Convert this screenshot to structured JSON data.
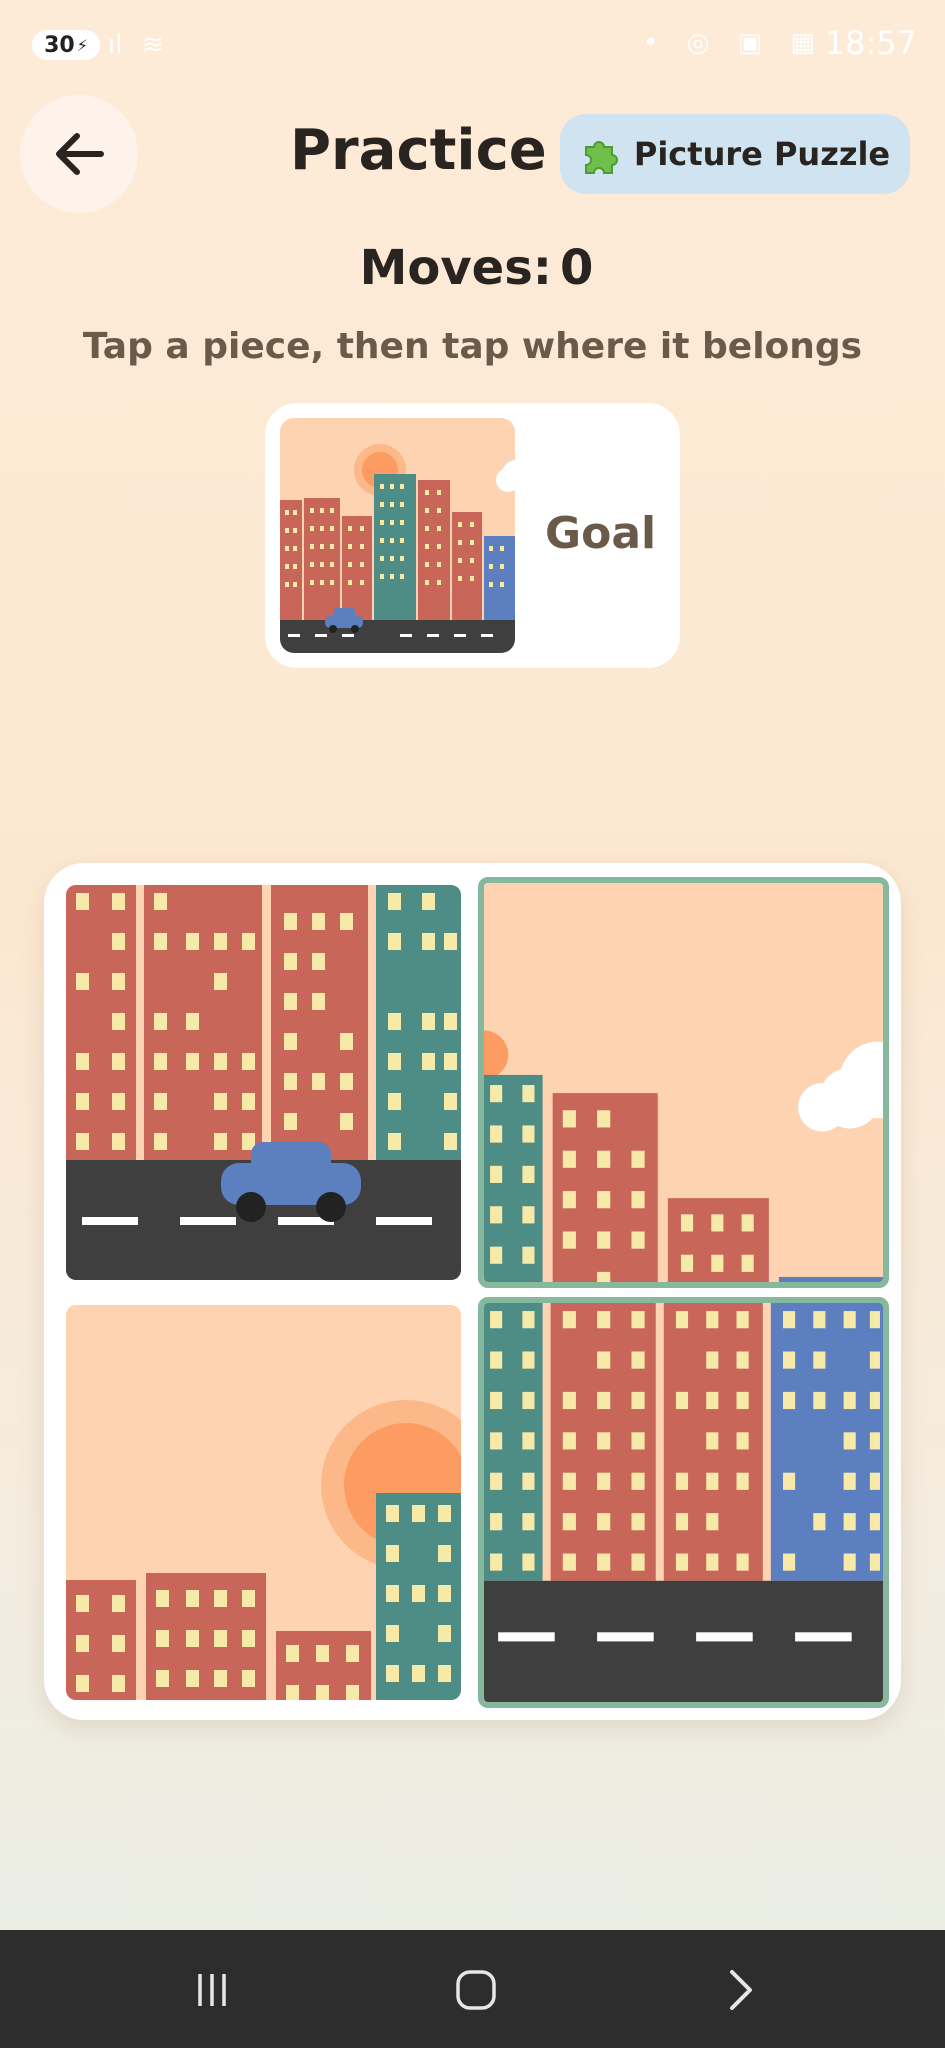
{
  "status_bar": {
    "battery": "30",
    "time": "18:57"
  },
  "header": {
    "title": "Practice",
    "mode_badge": "Picture Puzzle",
    "back_icon": "arrow-left-icon",
    "badge_icon": "puzzle-piece-icon"
  },
  "game": {
    "moves_label": "Moves:",
    "moves_value": "0",
    "instructions": "Tap a piece, then tap where it belongs",
    "goal_label": "Goal"
  },
  "board": {
    "pieces": [
      {
        "slot": 1,
        "content": "bottom-left street with car",
        "correct": false
      },
      {
        "slot": 2,
        "content": "top-right sky with cloud",
        "correct": true
      },
      {
        "slot": 3,
        "content": "top-left sky with sun",
        "correct": false
      },
      {
        "slot": 4,
        "content": "bottom-right buildings and road",
        "correct": true
      }
    ]
  },
  "colors": {
    "building_red": "#c8665a",
    "building_teal": "#4e8c86",
    "building_blue": "#5b7fbf",
    "window": "#f7e9a8",
    "sky": "#fdd3b2",
    "sun": "#fc9c62",
    "road": "#3f3f3f",
    "correct_border": "#86b89d",
    "badge_bg": "#cfe4f0"
  },
  "nav": {
    "icons": [
      "recent-apps-icon",
      "home-icon",
      "back-chevron-icon"
    ]
  }
}
